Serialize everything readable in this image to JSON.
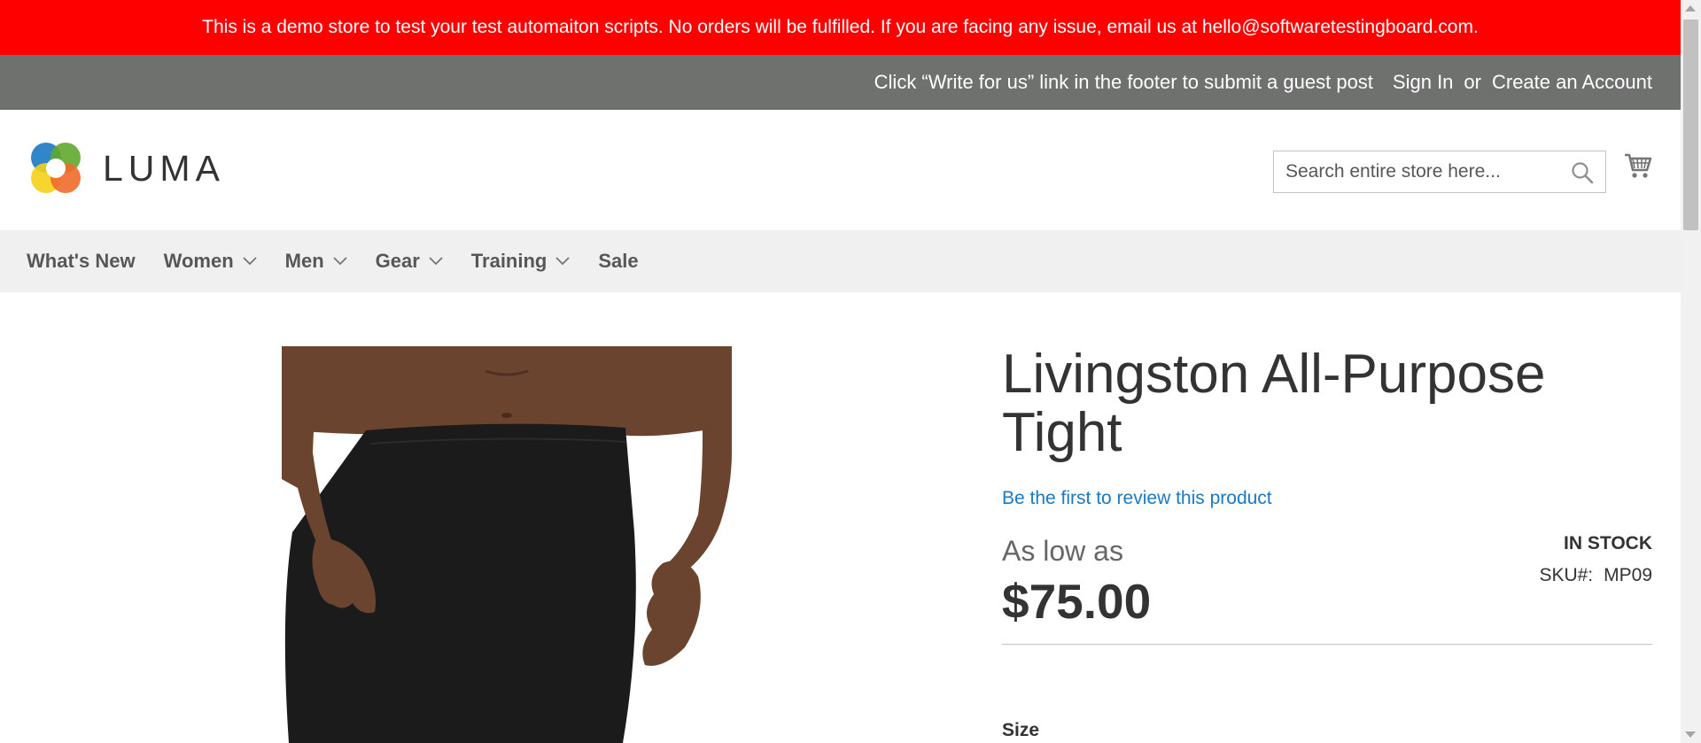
{
  "banner": {
    "text": "This is a demo store to test your test automaiton scripts. No orders will be fulfilled. If you are facing any issue, email us at hello@softwaretestingboard.com."
  },
  "top_bar": {
    "guest_post_text": "Click “Write for us” link in the footer to submit a guest post",
    "sign_in": "Sign In",
    "or": "or",
    "create_account": "Create an Account"
  },
  "header": {
    "logo_text": "LUMA",
    "search_placeholder": "Search entire store here...",
    "search_value": ""
  },
  "nav": {
    "items": [
      {
        "label": "What's New",
        "has_dropdown": false
      },
      {
        "label": "Women",
        "has_dropdown": true
      },
      {
        "label": "Men",
        "has_dropdown": true
      },
      {
        "label": "Gear",
        "has_dropdown": true
      },
      {
        "label": "Training",
        "has_dropdown": true
      },
      {
        "label": "Sale",
        "has_dropdown": false
      }
    ]
  },
  "product": {
    "title": "Livingston All-Purpose Tight",
    "review_link": "Be the first to review this product",
    "price_prefix": "As low as",
    "price": "$75.00",
    "stock_status": "IN STOCK",
    "sku_label": "SKU#:",
    "sku_value": "MP09",
    "size_label": "Size"
  },
  "colors": {
    "banner_bg": "#ff0000",
    "top_bar_bg": "#6e716e",
    "nav_bg": "#f0f0f0",
    "link_blue": "#1979c3",
    "product_black": "#1b1b1b",
    "skin": "#6b4430"
  },
  "icons": [
    "luma-logo-icon",
    "search-icon",
    "cart-icon",
    "chevron-down-icon"
  ]
}
